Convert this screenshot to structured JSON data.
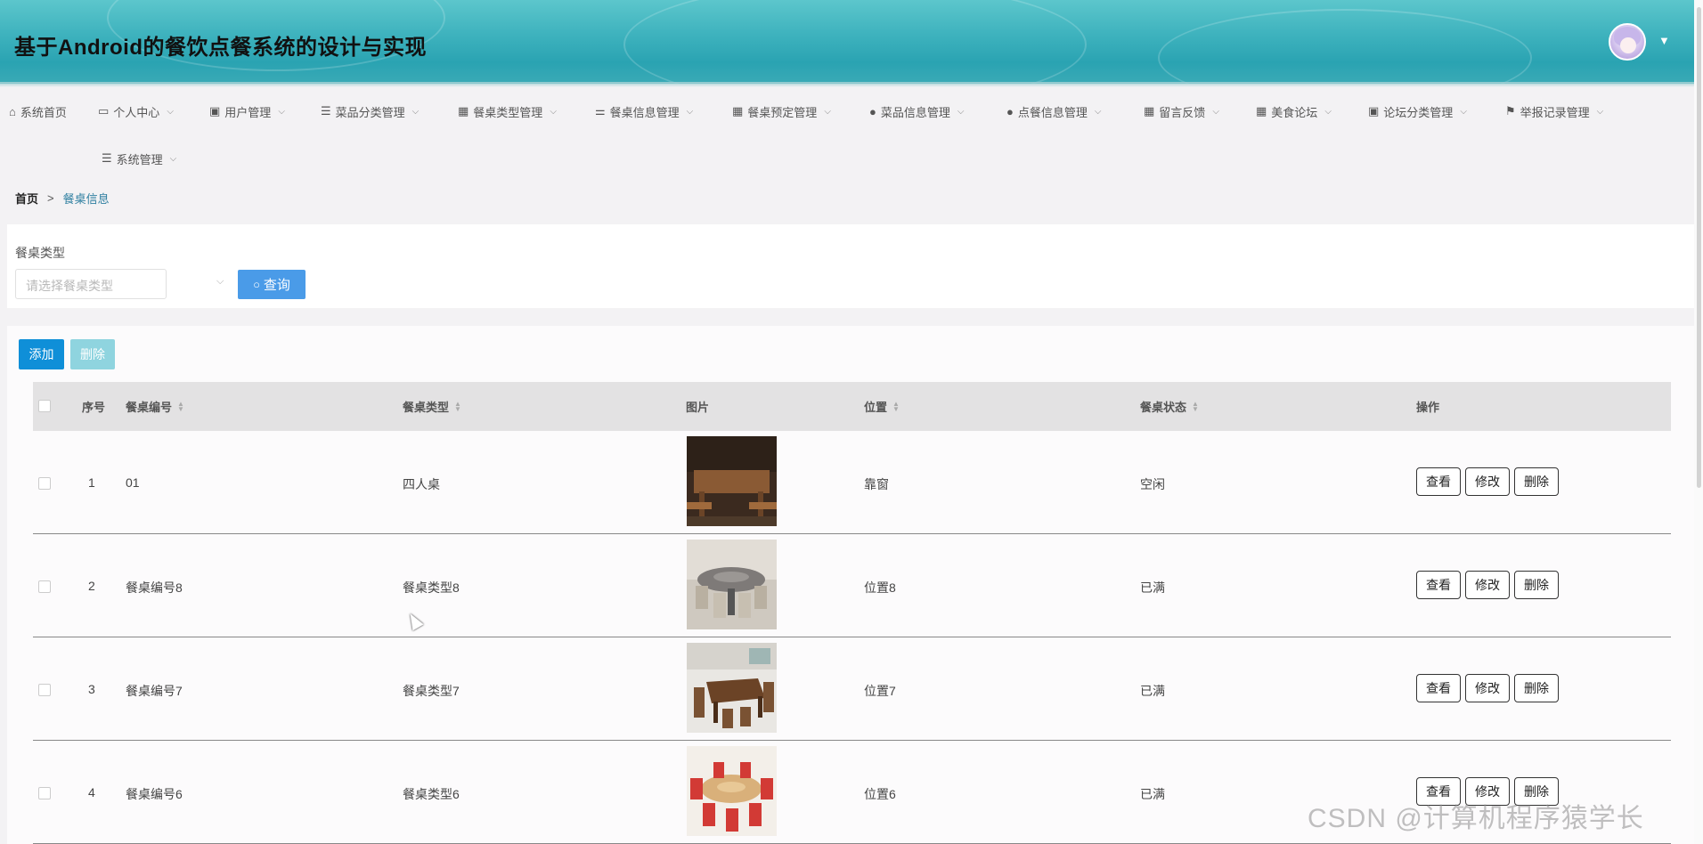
{
  "header": {
    "title": "基于Android的餐饮点餐系统的设计与实现"
  },
  "nav": [
    {
      "label": "系统首页",
      "icon": "home-icon",
      "chevron": false
    },
    {
      "label": "个人中心",
      "icon": "user-center-icon",
      "chevron": true
    },
    {
      "label": "用户管理",
      "icon": "clipboard-icon",
      "chevron": true
    },
    {
      "label": "菜品分类管理",
      "icon": "list-icon",
      "chevron": true
    },
    {
      "label": "餐桌类型管理",
      "icon": "grid-icon",
      "chevron": true
    },
    {
      "label": "餐桌信息管理",
      "icon": "sliders-icon",
      "chevron": true
    },
    {
      "label": "餐桌预定管理",
      "icon": "grid-icon",
      "chevron": true
    },
    {
      "label": "菜品信息管理",
      "icon": "person-icon",
      "chevron": true
    },
    {
      "label": "点餐信息管理",
      "icon": "person-icon",
      "chevron": true
    },
    {
      "label": "留言反馈",
      "icon": "grid-icon",
      "chevron": true
    },
    {
      "label": "美食论坛",
      "icon": "grid-icon",
      "chevron": true
    },
    {
      "label": "论坛分类管理",
      "icon": "clipboard-x-icon",
      "chevron": true
    },
    {
      "label": "举报记录管理",
      "icon": "flag-icon",
      "chevron": true
    },
    {
      "label": "系统管理",
      "icon": "list-icon",
      "chevron": true
    }
  ],
  "breadcrumb": {
    "home": "首页",
    "separator": ">",
    "current": "餐桌信息"
  },
  "search": {
    "label": "餐桌类型",
    "placeholder": "请选择餐桌类型",
    "button_label": "查询"
  },
  "toolbar": {
    "add_label": "添加",
    "delete_label": "删除"
  },
  "table": {
    "columns": [
      "序号",
      "餐桌编号",
      "餐桌类型",
      "图片",
      "位置",
      "餐桌状态",
      "操作"
    ],
    "actions": [
      "查看",
      "修改",
      "删除"
    ],
    "rows": [
      {
        "index": "1",
        "code": "01",
        "type": "四人桌",
        "location": "靠窗",
        "status": "空闲",
        "image": "wooden-four-seat-table"
      },
      {
        "index": "2",
        "code": "餐桌编号8",
        "type": "餐桌类型8",
        "location": "位置8",
        "status": "已满",
        "image": "round-grey-table"
      },
      {
        "index": "3",
        "code": "餐桌编号7",
        "type": "餐桌类型7",
        "location": "位置7",
        "status": "已满",
        "image": "walnut-six-seat-table"
      },
      {
        "index": "4",
        "code": "餐桌编号6",
        "type": "餐桌类型6",
        "location": "位置6",
        "status": "已满",
        "image": "round-red-chair-table"
      }
    ]
  },
  "watermark": "CSDN @计算机程序猿学长",
  "colors": {
    "header": "#3fb3be",
    "primary": "#0f8fd8",
    "search_button": "#4a9be8",
    "link": "#2e7fa0"
  }
}
